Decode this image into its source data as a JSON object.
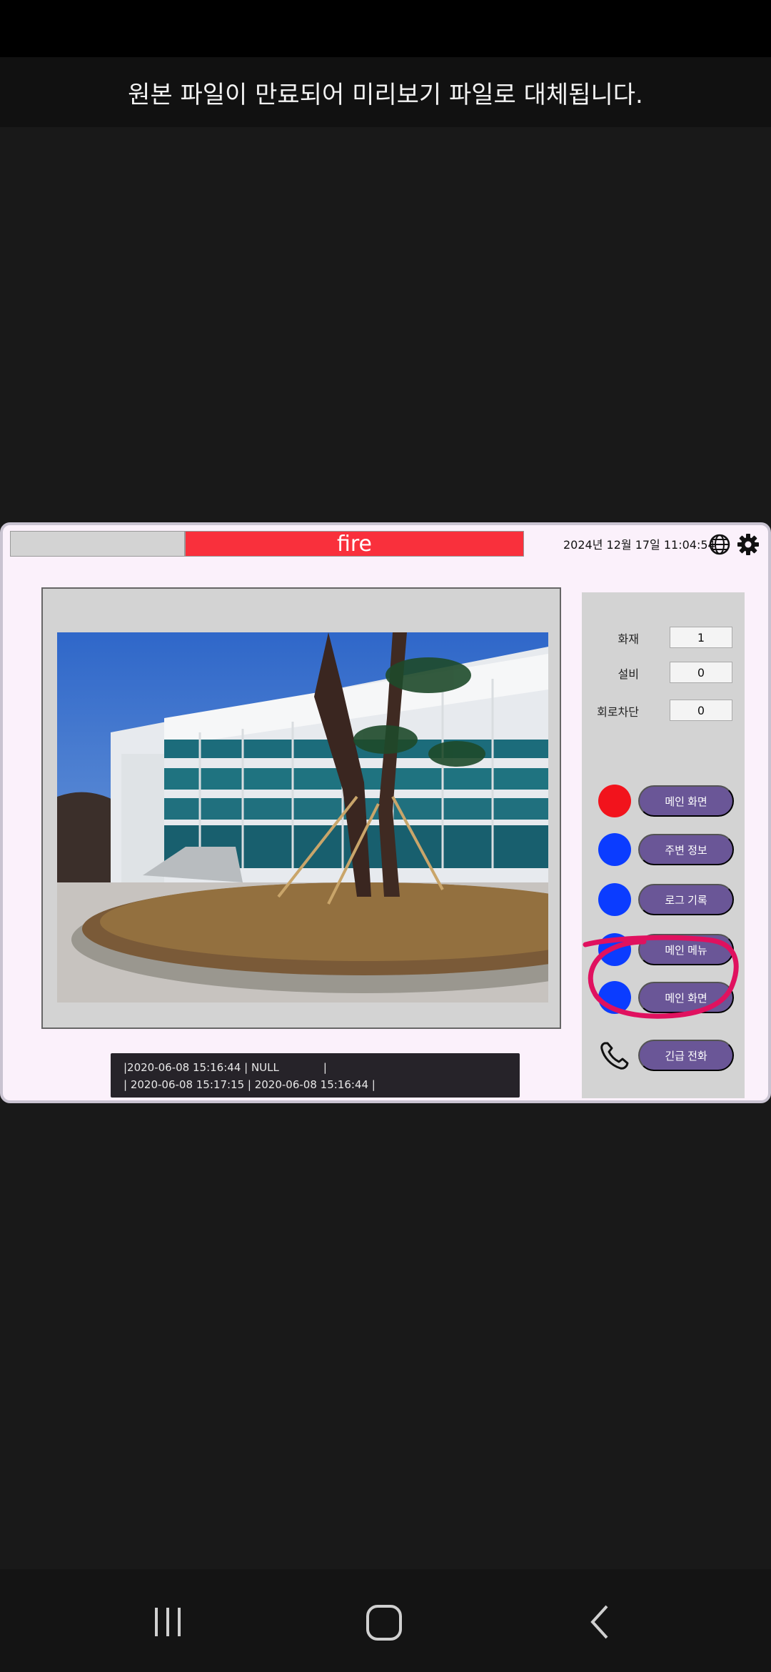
{
  "notice": "원본 파일이 만료되어 미리보기 파일로 대체됩니다.",
  "header": {
    "title": "fire",
    "datetime": "2024년 12월 17일 11:04:54"
  },
  "counts": [
    {
      "label": "화재",
      "value": "1"
    },
    {
      "label": "설비",
      "value": "0"
    },
    {
      "label": "회로차단",
      "value": "0"
    }
  ],
  "nav": [
    {
      "label": "메인 화면",
      "dot_color": "#f2131c"
    },
    {
      "label": "주변 정보",
      "dot_color": "#0b3cff"
    },
    {
      "label": "로그 기록",
      "dot_color": "#0b3cff"
    },
    {
      "label": "메인 메뉴",
      "dot_color": "#0b3cff"
    },
    {
      "label": "메인 화면",
      "dot_color": "#0b3cff"
    },
    {
      "label": "긴급 전화",
      "icon": "phone-icon"
    }
  ],
  "log": [
    "|2020-06-08 15:16:44 | NULL             |",
    "| 2020-06-08 15:17:15 | 2020-06-08 15:16:44 |"
  ],
  "colors": {
    "accent_red": "#f9303c",
    "button_purple": "#6a5697",
    "annotation": "#e0115f"
  }
}
